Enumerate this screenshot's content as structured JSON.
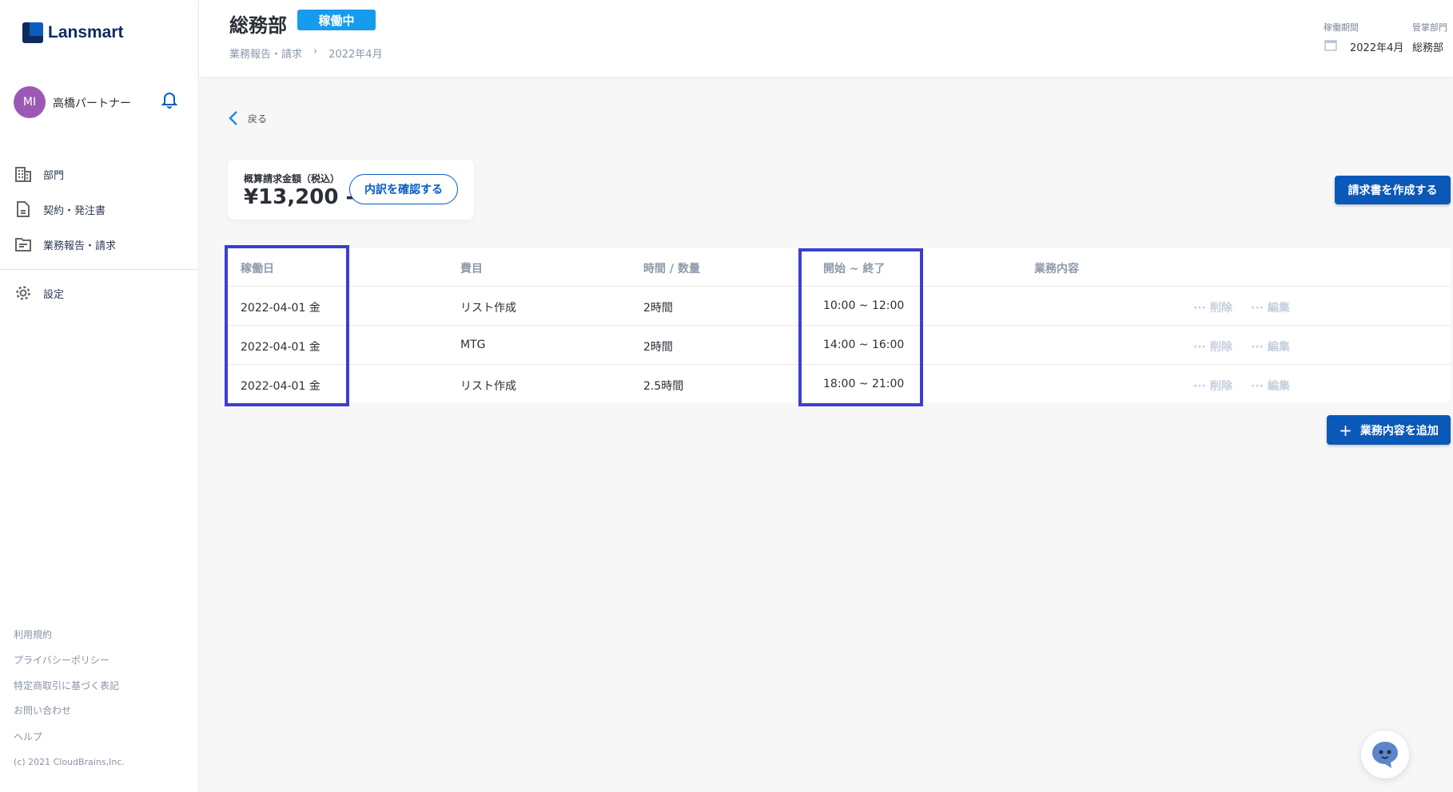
{
  "brand": {
    "name": "Lansmart"
  },
  "user": {
    "initials": "MI",
    "name": "高橋パートナー"
  },
  "sidebar": {
    "items": [
      {
        "label": "部門",
        "icon": "building-icon"
      },
      {
        "label": "契約・発注書",
        "icon": "document-icon"
      },
      {
        "label": "業務報告・請求",
        "icon": "folder-icon"
      },
      {
        "label": "設定",
        "icon": "gear-icon"
      }
    ],
    "footer": [
      "利用規約",
      "プライバシーポリシー",
      "特定商取引に基づく表記",
      "お問い合わせ",
      "ヘルプ"
    ],
    "copyright": "(c) 2021 CloudBrains,Inc."
  },
  "header": {
    "title": "総務部",
    "status": "稼働中",
    "breadcrumb": [
      "業務報告・請求",
      "2022年4月"
    ],
    "period_label": "稼働期間",
    "period_value": "2022年4月",
    "dept_label": "管掌部門",
    "dept_value": "総務部"
  },
  "main": {
    "back": "戻る",
    "summary": {
      "label": "概算請求金額（税込）",
      "amount": "¥13,200 -",
      "detail_button": "内訳を確認する"
    },
    "create_invoice": "請求書を作成する",
    "add_task": "業務内容を追加",
    "columns": [
      "稼働日",
      "費目",
      "時間 / 数量",
      "開始 ~ 終了",
      "業務内容"
    ],
    "rows": [
      {
        "date": "2022-04-01 金",
        "item": "リスト作成",
        "qty": "2時間",
        "time": "10:00 ~ 12:00",
        "desc": "",
        "delete": "削除",
        "edit": "編集"
      },
      {
        "date": "2022-04-01 金",
        "item": "MTG",
        "qty": "2時間",
        "time": "14:00 ~ 16:00",
        "desc": "",
        "delete": "削除",
        "edit": "編集"
      },
      {
        "date": "2022-04-01 金",
        "item": "リスト作成",
        "qty": "2.5時間",
        "time": "18:00 ~ 21:00",
        "desc": "",
        "delete": "削除",
        "edit": "編集"
      }
    ]
  },
  "colors": {
    "primary": "#0a58b8",
    "badge": "#169bee",
    "highlight": "#3b3fd1",
    "avatar": "#9b59b6"
  }
}
